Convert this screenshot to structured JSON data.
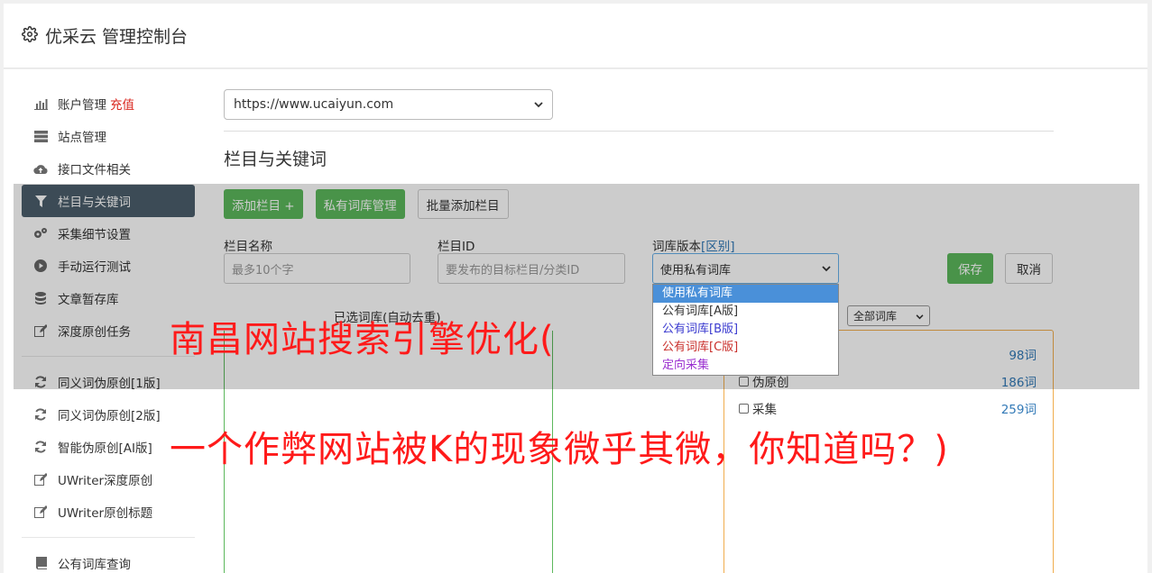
{
  "header": {
    "title": "优采云 管理控制台",
    "icon": "gear-icon"
  },
  "sidebar": {
    "group1": [
      {
        "label": "账户管理",
        "extra": "充值",
        "icon": "bar-chart-icon"
      },
      {
        "label": "站点管理",
        "icon": "server-icon"
      },
      {
        "label": "接口文件相关",
        "icon": "cloud-upload-icon"
      },
      {
        "label": "栏目与关键词",
        "icon": "filter-icon",
        "active": true
      },
      {
        "label": "采集细节设置",
        "icon": "cogs-icon"
      },
      {
        "label": "手动运行测试",
        "icon": "play-circle-icon"
      },
      {
        "label": "文章暂存库",
        "icon": "database-icon"
      },
      {
        "label": "深度原创任务",
        "icon": "edit-icon"
      }
    ],
    "group2": [
      {
        "label": "同义词伪原创[1版]",
        "icon": "refresh-icon"
      },
      {
        "label": "同义词伪原创[2版]",
        "icon": "refresh-icon"
      },
      {
        "label": "智能伪原创[AI版]",
        "icon": "refresh-icon"
      },
      {
        "label": "UWriter深度原创",
        "icon": "edit-icon"
      },
      {
        "label": "UWriter原创标题",
        "icon": "edit-icon"
      }
    ],
    "group3": [
      {
        "label": "公有词库查询",
        "icon": "book-icon"
      }
    ]
  },
  "main": {
    "site_select": "https://www.ucaiyun.com",
    "section_title": "栏目与关键词",
    "buttons": {
      "add_column": "添加栏目 +",
      "private_dict": "私有词库管理",
      "batch_add": "批量添加栏目"
    },
    "form": {
      "column_name_label": "栏目名称",
      "column_name_placeholder": "最多10个字",
      "column_id_label": "栏目ID",
      "column_id_placeholder": "要发布的目标栏目/分类ID",
      "dict_version_label": "词库版本",
      "dict_version_link": "[区别]",
      "dict_version_value": "使用私有词库",
      "save": "保存",
      "cancel": "取消"
    },
    "dict_options": [
      {
        "label": "使用私有词库",
        "color": "#ffffff"
      },
      {
        "label": "公有词库[A版]",
        "color": "#333333"
      },
      {
        "label": "公有词库[B版]",
        "color": "#3a3acf"
      },
      {
        "label": "公有词库[C版]",
        "color": "#c9302c"
      },
      {
        "label": "定向采集",
        "color": "#9b30d0"
      }
    ],
    "selected_keywords_label": "已选词库(自动去重)",
    "library_filter": "全部词库",
    "keyword_list": [
      {
        "name": "",
        "count": "98词"
      },
      {
        "name": "伪原创",
        "count": "186词"
      },
      {
        "name": "采集",
        "count": "259词"
      }
    ]
  },
  "overlay_text": {
    "line1": "南昌网站搜索引擎优化(",
    "line2": "一个作弊网站被K的现象微乎其微，你知道吗？)"
  }
}
